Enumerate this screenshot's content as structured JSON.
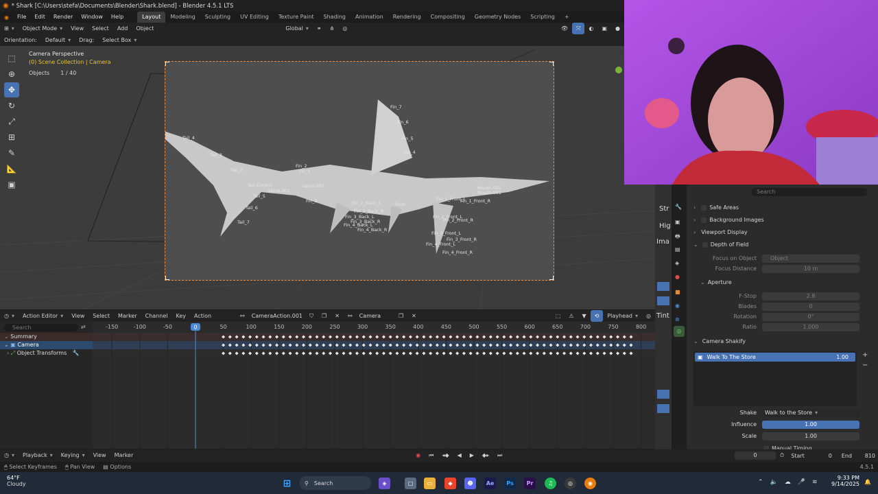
{
  "window": {
    "title": "* Shark [C:\\Users\\stefa\\Documents\\Blender\\Shark.blend] - Blender 4.5.1 LTS"
  },
  "menu": [
    "File",
    "Edit",
    "Render",
    "Window",
    "Help"
  ],
  "workspaces": [
    "Layout",
    "Modeling",
    "Sculpting",
    "UV Editing",
    "Texture Paint",
    "Shading",
    "Animation",
    "Rendering",
    "Compositing",
    "Geometry Nodes",
    "Scripting"
  ],
  "viewport_header": {
    "mode": "Object Mode",
    "items": [
      "View",
      "Select",
      "Add",
      "Object"
    ],
    "transform_orientation": "Global"
  },
  "tool_settings": {
    "orientation_label": "Orientation:",
    "orientation_value": "Default",
    "drag_label": "Drag:",
    "drag_value": "Select Box"
  },
  "viewport_info": {
    "perspective": "Camera Perspective",
    "collection": "(0) Scene Collection | Camera",
    "objects_label": "Objects",
    "objects_value": "1 / 40"
  },
  "bone_labels": [
    "Fin_7",
    "Fin_6",
    "Fin_5",
    "Fin_4",
    "Tail_4",
    "Tail_3",
    "Tail_2",
    "Fin_2",
    "Fin_1",
    "Tail Control",
    "Tail_5",
    "Tail_6",
    "Tail_7",
    "Fin_3",
    "spine.001",
    "spine.002",
    "Mouth.001",
    "Mouth.002",
    "Root",
    "Fin_2_Back_L",
    "Fin_2_Back_R",
    "Fin_3_Back_L",
    "Fin_3_Back_R",
    "Fin_4_Back_L",
    "Fin_4_Back_R",
    "Fin_1_Front_L",
    "Fin_2_Front_L",
    "Fin_2_Front_R",
    "Fin_3_Front_L",
    "Fin_3_Front_R",
    "Fin_4_Front_L",
    "Fin_4_Front_R",
    "Fin_1_Front_R"
  ],
  "action_editor": {
    "editor_name": "Action Editor",
    "menus": [
      "View",
      "Select",
      "Marker",
      "Channel",
      "Key",
      "Action"
    ],
    "action_name": "CameraAction.001",
    "slot_name": "Camera",
    "snap": "Playhead",
    "search_placeholder": "Search",
    "current_frame": "0",
    "frame_ticks": [
      "-150",
      "-100",
      "-50",
      "0",
      "50",
      "100",
      "150",
      "200",
      "250",
      "300",
      "350",
      "400",
      "450",
      "500",
      "550",
      "600",
      "650",
      "700",
      "750",
      "800"
    ],
    "channels": [
      {
        "label": "Summary"
      },
      {
        "label": "Camera"
      },
      {
        "label": "Object Transforms"
      }
    ]
  },
  "properties": {
    "search_placeholder": "Search",
    "panels": {
      "safe_areas": "Safe Areas",
      "background_images": "Background Images",
      "viewport_display": "Viewport Display",
      "depth_of_field": "Depth of Field",
      "focus_on_object_label": "Focus on Object",
      "focus_on_object_value": "Object",
      "focus_distance_label": "Focus Distance",
      "focus_distance_value": "10 m",
      "aperture": "Aperture",
      "fstop_label": "F-Stop",
      "fstop_value": "2.8",
      "blades_label": "Blades",
      "blades_value": "0",
      "rotation_label": "Rotation",
      "rotation_value": "0°",
      "ratio_label": "Ratio",
      "ratio_value": "1.000",
      "camera_shakify": "Camera Shakify",
      "shake_item_name": "Walk To The Store",
      "shake_item_value": "1.00",
      "shake_label": "Shake",
      "shake_value": "Walk to the Store",
      "influence_label": "Influence",
      "influence_value": "1.00",
      "scale_label": "Scale",
      "scale_value": "1.00",
      "manual_timing": "Manual Timing"
    },
    "strip_letters": [
      "Str",
      "Hig",
      "Ima",
      "Tint"
    ]
  },
  "timeline": {
    "menus": [
      "Playback",
      "Keying",
      "View",
      "Marker"
    ],
    "current": "0",
    "start_label": "Start",
    "start_value": "0",
    "end_label": "End",
    "end_value": "810"
  },
  "statusbar": {
    "select": "Select Keyframes",
    "pan": "Pan View",
    "options": "Options",
    "version": "4.5.1"
  },
  "taskbar": {
    "weather_temp": "64°F",
    "weather_desc": "Cloudy",
    "search": "Search",
    "time": "9:33 PM",
    "date": "9/14/2025"
  },
  "colors": {
    "accent": "#4772b3",
    "camera_frame": "#f08a3a",
    "playhead": "#4a8cd6"
  }
}
